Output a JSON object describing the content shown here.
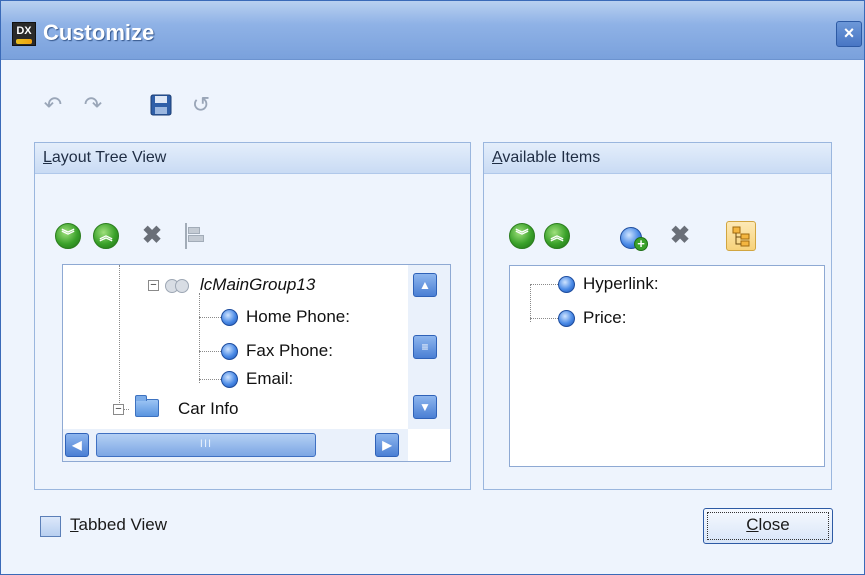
{
  "window": {
    "title": "Customize",
    "title_icon_text": "DX",
    "close_glyph": "×"
  },
  "toolbar": {
    "items": [
      {
        "name": "undo-icon",
        "glyph": "↶"
      },
      {
        "name": "redo-icon",
        "glyph": "↷"
      },
      {
        "name": "save-icon",
        "glyph": "▣"
      },
      {
        "name": "reset-icon",
        "glyph": "↺"
      }
    ]
  },
  "layout_tree": {
    "header_underline": "L",
    "header_rest": "ayout Tree View",
    "buttons": [
      "move-down-icon",
      "move-up-icon",
      "delete-icon",
      "align-icon"
    ],
    "group_label": "lcMainGroup13",
    "items": [
      "Home Phone:",
      "Fax Phone:",
      "Email:"
    ],
    "folder_label": "Car Info",
    "hscroll_grip": "III"
  },
  "available_items": {
    "header_underline": "A",
    "header_rest": "vailable Items",
    "buttons": [
      "move-down-icon",
      "move-up-icon",
      "add-item-icon",
      "delete-icon",
      "tree-view-icon"
    ],
    "items": [
      "Hyperlink:",
      "Price:"
    ]
  },
  "footer": {
    "tabbed_underline": "T",
    "tabbed_rest": "abbed View",
    "tabbed_checked": false,
    "close_underline": "C",
    "close_rest": "lose"
  },
  "colors": {
    "titlebar": "#8fb2e6",
    "window_bg": "#eef4fd",
    "accent_blue": "#4a7fd4",
    "green_button": "#3aa12a"
  }
}
